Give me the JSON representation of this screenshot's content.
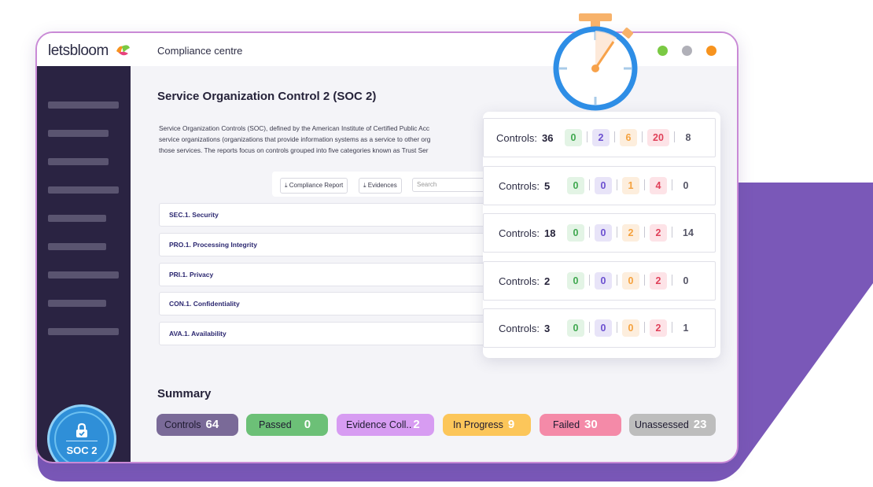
{
  "brand": {
    "name": "letsbloom",
    "logo_icon": "bloom-leaf-icon"
  },
  "app_title": "Compliance centre",
  "window_dots": [
    "#7ac943",
    "#b0b0b8",
    "#f7931e"
  ],
  "badge": {
    "label": "SOC 2",
    "icon": "lock-icon"
  },
  "page": {
    "title": "Service Organization Control 2  (SOC 2)",
    "description": [
      "Service Organization Controls (SOC), defined by the American Institute of Certified Public Acc",
      "service organizations (organizations that provide information systems as a service to other org",
      "those services. The reports focus on controls grouped into five categories known as Trust Ser"
    ]
  },
  "toolbar": {
    "compliance_report": "Compliance Report",
    "evidences": "Evidences",
    "search_placeholder": "Search"
  },
  "categories": [
    "SEC.1. Security",
    "PRO.1. Processing Integrity",
    "PRI.1. Privacy",
    "CON.1. Confidentiality",
    "AVA.1. Availability"
  ],
  "panel": {
    "label": "Controls:",
    "rows": [
      {
        "total": "36",
        "passed": "0",
        "evidence": "2",
        "progress": "6",
        "failed": "20",
        "unassessed": "8"
      },
      {
        "total": "5",
        "passed": "0",
        "evidence": "0",
        "progress": "1",
        "failed": "4",
        "unassessed": "0"
      },
      {
        "total": "18",
        "passed": "0",
        "evidence": "0",
        "progress": "2",
        "failed": "2",
        "unassessed": "14"
      },
      {
        "total": "2",
        "passed": "0",
        "evidence": "0",
        "progress": "0",
        "failed": "2",
        "unassessed": "0"
      },
      {
        "total": "3",
        "passed": "0",
        "evidence": "0",
        "progress": "0",
        "failed": "2",
        "unassessed": "1"
      }
    ]
  },
  "summary": {
    "title": "Summary",
    "pills": [
      {
        "label": "Controls",
        "value": "64",
        "bg": "#7a6a98",
        "fg": "#ffffff",
        "fg_label": "#1e1a30"
      },
      {
        "label": "Passed",
        "value": "0",
        "bg": "#6cc077",
        "fg": "#ffffff",
        "fg_label": "#1e1a30"
      },
      {
        "label": "Evidence Coll..",
        "value": "2",
        "bg": "#d79cf2",
        "fg": "#ffffff",
        "fg_label": "#1e1a30"
      },
      {
        "label": "In Progress",
        "value": "9",
        "bg": "#fcc65a",
        "fg": "#ffffff",
        "fg_label": "#1e1a30"
      },
      {
        "label": "Failed",
        "value": "30",
        "bg": "#f48aa8",
        "fg": "#ffffff",
        "fg_label": "#1e1a30"
      },
      {
        "label": "Unassessed",
        "value": "23",
        "bg": "#bdbdbd",
        "fg": "#ffffff",
        "fg_label": "#1e1a30"
      }
    ]
  },
  "colors": {
    "accent_purple": "#7a58b8",
    "sidebar": "#2a2342",
    "chip_passed": "#e3f4e5",
    "chip_passed_text": "#3fa84f",
    "chip_evidence": "#e8e4f8",
    "chip_evidence_text": "#6b4fd0",
    "chip_progress": "#fdeedd",
    "chip_progress_text": "#f5a13c",
    "chip_failed": "#fde3e7",
    "chip_failed_text": "#e04059",
    "chip_unassessed_text": "#555566"
  },
  "decorations": {
    "timer_icon": "stopwatch-icon"
  }
}
